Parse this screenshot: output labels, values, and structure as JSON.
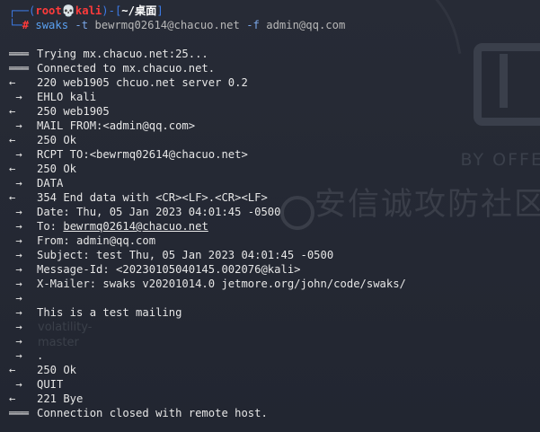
{
  "prompt": {
    "line1_open": "┌──(",
    "user": "root",
    "skull": "💀",
    "host": "kali",
    "line1_mid": ")-[",
    "cwd": "~/桌面",
    "line1_close": "]",
    "line2_branch": "└─",
    "hash": "#",
    "command": "swaks",
    "opt_t": "-t",
    "arg_t": "bewrmq02614@chacuo.net",
    "opt_f": "-f",
    "arg_f": "admin@qq.com"
  },
  "transcript": [
    {
      "arrow": "===",
      "text": "Trying mx.chacuo.net:25..."
    },
    {
      "arrow": "===",
      "text": "Connected to mx.chacuo.net."
    },
    {
      "arrow": "<-",
      "text": "220 web1905 chcuo.net server 0.2"
    },
    {
      "arrow": "->",
      "text": "EHLO kali"
    },
    {
      "arrow": "<-",
      "text": "250 web1905"
    },
    {
      "arrow": "->",
      "text": "MAIL FROM:<admin@qq.com>"
    },
    {
      "arrow": "<-",
      "text": "250 Ok"
    },
    {
      "arrow": "->",
      "text": "RCPT TO:<bewrmq02614@chacuo.net>"
    },
    {
      "arrow": "<-",
      "text": "250 Ok"
    },
    {
      "arrow": "->",
      "text": "DATA"
    },
    {
      "arrow": "<-",
      "text": "354 End data with <CR><LF>.<CR><LF>"
    },
    {
      "arrow": "->",
      "text": "Date: Thu, 05 Jan 2023 04:01:45 -0500"
    },
    {
      "arrow": "->",
      "text": "To: bewrmq02614@chacuo.net"
    },
    {
      "arrow": "->",
      "text": "From: admin@qq.com"
    },
    {
      "arrow": "->",
      "text": "Subject: test Thu, 05 Jan 2023 04:01:45 -0500"
    },
    {
      "arrow": "->",
      "text": "Message-Id: <20230105040145.002076@kali>"
    },
    {
      "arrow": "->",
      "text": "X-Mailer: swaks v20201014.0 jetmore.org/john/code/swaks/"
    },
    {
      "arrow": "->",
      "text": ""
    },
    {
      "arrow": "->",
      "text": "This is a test mailing"
    },
    {
      "arrow": "->",
      "text": ""
    },
    {
      "arrow": "->",
      "text": ""
    },
    {
      "arrow": "->",
      "text": "."
    },
    {
      "arrow": "<-",
      "text": "250 Ok"
    },
    {
      "arrow": "->",
      "text": "QUIT"
    },
    {
      "arrow": "<-",
      "text": "221 Bye"
    },
    {
      "arrow": "===",
      "text": "Connection closed with remote host."
    }
  ],
  "to_prefix": "To: ",
  "to_address": "bewrmq02614@chacuo.net",
  "wallpaper": {
    "brand_text": "BY OFFE",
    "watermark_text": "安信诚攻防社区",
    "file_label_1": "volatility-",
    "file_label_2": "master"
  },
  "colors": {
    "background": "#232733",
    "prompt_blue": "#3e7ce8",
    "prompt_red": "#ff3b3b",
    "text": "#e6e6e6"
  }
}
